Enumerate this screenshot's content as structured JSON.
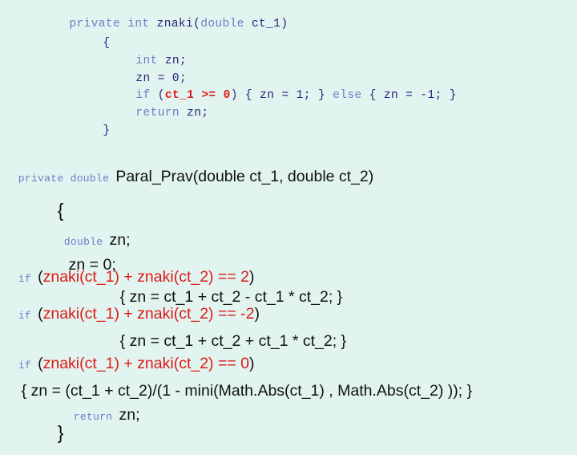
{
  "slide": {
    "background_color": "#e2f4f0",
    "keyword_color": "#6a7ec8",
    "identifier_color": "#26267a",
    "highlight_color": "#dd1a16",
    "body_text_color": "#101010",
    "code_blocks": [
      {
        "name": "znaki-method",
        "lines": [
          {
            "id": "a1",
            "segments": [
              {
                "style": "keyword",
                "text": "private int "
              },
              {
                "style": "identifier",
                "text": "znaki("
              },
              {
                "style": "keyword",
                "text": "double"
              },
              {
                "style": "identifier",
                "text": " ct_1)"
              }
            ],
            "plain": "private int znaki(double ct_1)"
          },
          {
            "id": "a2",
            "segments": [
              {
                "style": "identifier",
                "text": "{"
              }
            ],
            "plain": "{"
          },
          {
            "id": "a3",
            "segments": [
              {
                "style": "keyword",
                "text": "int"
              },
              {
                "style": "identifier",
                "text": " zn;"
              }
            ],
            "plain": "int zn;"
          },
          {
            "id": "a4",
            "segments": [
              {
                "style": "identifier",
                "text": "zn = 0;"
              }
            ],
            "plain": "zn = 0;"
          },
          {
            "id": "a5",
            "segments": [
              {
                "style": "keyword",
                "text": "if"
              },
              {
                "style": "identifier",
                "text": " ("
              },
              {
                "style": "highlight-bold",
                "text": "ct_1 >= 0"
              },
              {
                "style": "identifier",
                "text": ") { zn = 1; } "
              },
              {
                "style": "keyword",
                "text": "else"
              },
              {
                "style": "identifier",
                "text": " { zn = -1; }"
              }
            ],
            "plain": "if (ct_1 >= 0) { zn = 1; } else { zn = -1; }"
          },
          {
            "id": "a6",
            "segments": [
              {
                "style": "keyword",
                "text": "return"
              },
              {
                "style": "identifier",
                "text": " zn;"
              }
            ],
            "plain": "return zn;"
          },
          {
            "id": "a7",
            "segments": [
              {
                "style": "identifier",
                "text": "}"
              }
            ],
            "plain": "}"
          }
        ]
      },
      {
        "name": "paral-prav-method",
        "lines": [
          {
            "id": "b1",
            "segments": [
              {
                "style": "keyword-mono",
                "text": "private double "
              },
              {
                "style": "body",
                "text": "Paral_Prav(double ct_1, double ct_2)"
              }
            ],
            "plain": "private double Paral_Prav(double ct_1, double ct_2)"
          },
          {
            "id": "b2",
            "segments": [
              {
                "style": "brace",
                "text": "{"
              }
            ],
            "plain": "{"
          },
          {
            "id": "b3",
            "segments": [
              {
                "style": "keyword-mono",
                "text": "double "
              },
              {
                "style": "body",
                "text": "zn;"
              }
            ],
            "plain": "double zn;"
          },
          {
            "id": "b4",
            "segments": [
              {
                "style": "body",
                "text": "zn = 0;"
              }
            ],
            "plain": "zn = 0;"
          },
          {
            "id": "b5",
            "segments": [
              {
                "style": "keyword-mono",
                "text": "if "
              },
              {
                "style": "body",
                "text": "("
              },
              {
                "style": "highlight",
                "text": "znaki(ct_1) + znaki(ct_2) == 2"
              },
              {
                "style": "body",
                "text": ")"
              }
            ],
            "plain": "if (znaki(ct_1) + znaki(ct_2) == 2)"
          },
          {
            "id": "b6",
            "segments": [
              {
                "style": "body",
                "text": "{ zn = ct_1 + ct_2 - ct_1 * ct_2; }"
              }
            ],
            "plain": "{ zn = ct_1 + ct_2 - ct_1 * ct_2; }"
          },
          {
            "id": "b7",
            "segments": [
              {
                "style": "keyword-mono",
                "text": "if "
              },
              {
                "style": "body",
                "text": "("
              },
              {
                "style": "highlight",
                "text": "znaki(ct_1) + znaki(ct_2) == -2"
              },
              {
                "style": "body",
                "text": ")"
              }
            ],
            "plain": "if (znaki(ct_1) + znaki(ct_2) == -2)"
          },
          {
            "id": "b8",
            "segments": [
              {
                "style": "body",
                "text": "{ zn = ct_1 + ct_2 + ct_1 * ct_2; }"
              }
            ],
            "plain": "{ zn = ct_1 + ct_2 + ct_1 * ct_2; }"
          },
          {
            "id": "b9",
            "segments": [
              {
                "style": "keyword-mono",
                "text": "if "
              },
              {
                "style": "body",
                "text": "("
              },
              {
                "style": "highlight",
                "text": "znaki(ct_1) + znaki(ct_2) == 0"
              },
              {
                "style": "body",
                "text": ")"
              }
            ],
            "plain": "if (znaki(ct_1) + znaki(ct_2) == 0)"
          },
          {
            "id": "b10",
            "segments": [
              {
                "style": "body",
                "text": "{ zn = (ct_1 + ct_2)/(1 - mini(Math.Abs(ct_1) , Math.Abs(ct_2) )); }"
              }
            ],
            "plain": "{ zn = (ct_1 + ct_2)/(1 - mini(Math.Abs(ct_1) , Math.Abs(ct_2) )); }"
          },
          {
            "id": "b11",
            "segments": [
              {
                "style": "keyword-mono",
                "text": "return "
              },
              {
                "style": "body",
                "text": "zn;"
              }
            ],
            "plain": "return zn;"
          },
          {
            "id": "b12",
            "segments": [
              {
                "style": "brace",
                "text": "}"
              }
            ],
            "plain": "}"
          }
        ]
      }
    ],
    "text": {
      "a1_kw1": "private int ",
      "a1_id1": "znaki(",
      "a1_kw2": "double",
      "a1_id2": " ct_1)",
      "a2": "{",
      "a3_kw": "int",
      "a3_id": " zn;",
      "a4": "zn = 0;",
      "a5_kw_if": "if",
      "a5_p1": " (",
      "a5_red": "ct_1 >= 0",
      "a5_p2": ") { zn = 1; } ",
      "a5_kw_else": "else",
      "a5_p3": " { zn = -1; }",
      "a6_kw": "return",
      "a6_id": " zn;",
      "a7": "}",
      "b1_kw": "private double ",
      "b1_body": "Paral_Prav(double ct_1, double ct_2)",
      "b2": "{",
      "b3_kw": "double ",
      "b3_body": "zn;",
      "b4": "zn = 0;",
      "b5_kw": "if ",
      "b5_open": "(",
      "b5_red": "znaki(ct_1) + znaki(ct_2) == 2",
      "b5_close": ")",
      "b6": "{ zn = ct_1 + ct_2 - ct_1 * ct_2; }",
      "b7_kw": "if ",
      "b7_open": "(",
      "b7_red": "znaki(ct_1) + znaki(ct_2) == -2",
      "b7_close": ")",
      "b8": "{ zn = ct_1 + ct_2 + ct_1 * ct_2; }",
      "b9_kw": "if ",
      "b9_open": "(",
      "b9_red": "znaki(ct_1) + znaki(ct_2) == 0",
      "b9_close": ")",
      "b10": "{ zn = (ct_1 + ct_2)/(1 - mini(Math.Abs(ct_1) , Math.Abs(ct_2) )); }",
      "b11_kw": "return ",
      "b11_body": "zn;",
      "b12": "}"
    }
  }
}
